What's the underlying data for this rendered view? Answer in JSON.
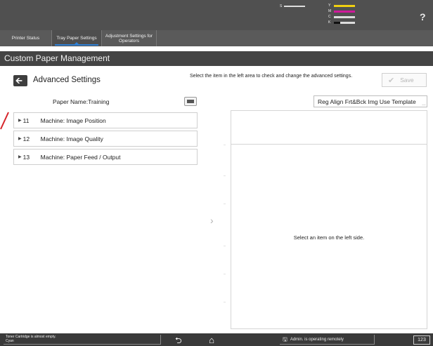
{
  "header": {
    "toner": [
      {
        "label": "S",
        "color": "#dddddd",
        "level": 1.0
      },
      {
        "label": "Y",
        "color": "#f0d010",
        "level": 1.0
      },
      {
        "label": "M",
        "color": "#d0189a",
        "level": 1.0
      },
      {
        "label": "C",
        "color": "#dddddd",
        "level": 1.0
      },
      {
        "label": "K",
        "color": "#111111",
        "level": 0.3
      }
    ],
    "help_label": "?"
  },
  "tabs": [
    {
      "label": "Printer Status"
    },
    {
      "label": "Tray Paper Settings"
    },
    {
      "label": "Adjustment Settings for Operators"
    }
  ],
  "title": "Custom Paper Management",
  "left": {
    "heading": "Advanced Settings",
    "paper_name": "Paper Name:Training",
    "items": [
      {
        "num": "11",
        "label": "Machine: Image Position"
      },
      {
        "num": "12",
        "label": "Machine: Image Quality"
      },
      {
        "num": "13",
        "label": "Machine: Paper Feed / Output"
      }
    ]
  },
  "right": {
    "instruction": "Select the item in the left area to check and change the advanced settings.",
    "save_label": "Save",
    "reg_align_label": "Reg Align Frt&Bck Img Use Template",
    "empty_message": "Select an item on the left side."
  },
  "statusbar": {
    "message_line1": "Toner Cartridge is almost empty.",
    "message_line2": "Cyan",
    "remote_label": "Admin. is operating remotely",
    "keypad_label": "123"
  },
  "colors": {
    "accent": "#2f7fd3",
    "header_bg": "#505050",
    "title_bg": "#444444",
    "marker_red": "#d6242a"
  }
}
